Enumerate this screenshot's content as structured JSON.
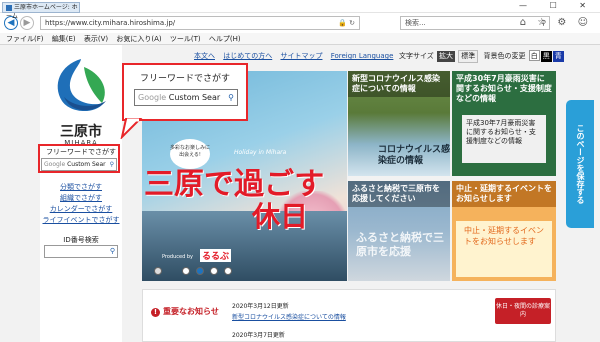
{
  "browser": {
    "tab_title": "三原市ホームページ: ホーム",
    "url": "https://www.city.mihara.hiroshima.jp/",
    "search_placeholder": "検索...",
    "menu": [
      "ファイル(F)",
      "編集(E)",
      "表示(V)",
      "お気に入り(A)",
      "ツール(T)",
      "ヘルプ(H)"
    ],
    "window_controls": "— ☐ ✕",
    "toolbar_icons": "⌂ ☆ ⚙ ☺"
  },
  "site": {
    "city_name": "三原市",
    "city_roman": "MIHARA",
    "search_label": "フリーワードでさがす",
    "search_placeholder_brand": "Google",
    "search_placeholder_text": " Custom Sear",
    "id_search_label": "ID番号検索",
    "left_links": [
      "分類でさがす",
      "組織でさがす",
      "カレンダーでさがす",
      "ライフイベントでさがす"
    ]
  },
  "callout": {
    "label": "フリーワードでさがす",
    "brand": "Google",
    "text": " Custom Sear"
  },
  "topnav": {
    "links": [
      "本文へ",
      "はじめての方へ",
      "サイトマップ",
      "Foreign Language"
    ],
    "font_size_label": "文字サイズ",
    "enlarge": "拡大",
    "standard": "標準",
    "bg_label": "背景色の変更",
    "bg_white": "白",
    "bg_black": "黒",
    "bg_blue": "青"
  },
  "hero": {
    "title_line1": "三原で過ごす",
    "title_line2": "休日",
    "bubble": "多彩なお楽しみに出会える!",
    "holiday": "Holiday in Mihara",
    "produced_by": "Produced by",
    "brand": "るるぶ"
  },
  "tiles": {
    "covid_caption": "新型コロナウイルス感染症についての情報",
    "covid_art": "コロナウイルス感染症の情報",
    "rain_caption": "平成30年7月豪雨災害に関するお知らせ・支援制度などの情報",
    "rain_inner": "平成30年7月豪雨災害に関するお知らせ・支援制度などの情報",
    "furusato_caption": "ふるさと納税で三原市を応援してください",
    "furusato_art": "ふるさと納税で三原市を応援",
    "event_caption": "中止・延期するイベントをお知らせします",
    "event_inner": "中止・延期するイベントをお知らせします"
  },
  "save_tab": "このページを保存する",
  "notices": {
    "heading": "重要なお知らせ",
    "date1": "2020年3月12日更新",
    "link1": "新型コロナウイルス感染症についての情報",
    "date2": "2020年3月7日更新",
    "button": "休日・夜間の診療案内"
  }
}
